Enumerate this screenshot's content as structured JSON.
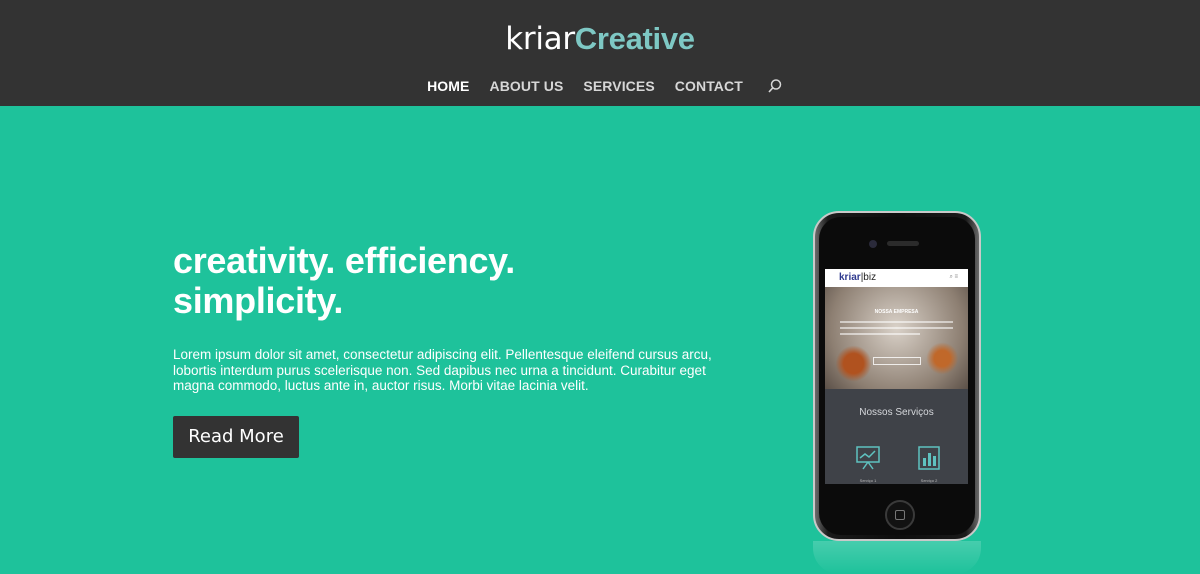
{
  "header": {
    "logo_part1": "kriar",
    "logo_part2": "Creative",
    "nav": [
      {
        "label": "HOME",
        "active": true
      },
      {
        "label": "ABOUT US",
        "active": false
      },
      {
        "label": "SERVICES",
        "active": false
      },
      {
        "label": "CONTACT",
        "active": false
      }
    ],
    "search_icon": "search-icon"
  },
  "hero": {
    "title_line1": "creativity. efficiency.",
    "title_line2": "simplicity.",
    "body": "Lorem ipsum dolor sit amet, consectetur adipiscing elit. Pellentesque eleifend cursus arcu, lobortis interdum purus scelerisque non. Sed dapibus nec urna a tincidunt. Curabitur eget magna commodo, luctus ante in, auctor risus. Morbi vitae lacinia velit.",
    "button": "Read More"
  },
  "phone_screen": {
    "logo_brand": "kriar",
    "logo_suffix": "biz",
    "header_icons": "⌕  ≡",
    "hero_title": "NOSSA EMPRESA",
    "services_title": "Nossos Serviços",
    "service1": "Serviço 1",
    "service2": "Serviço 2"
  },
  "colors": {
    "header_bg": "#333333",
    "hero_bg": "#1ec29b",
    "logo_accent": "#7ec8c4",
    "button_bg": "#333333"
  }
}
